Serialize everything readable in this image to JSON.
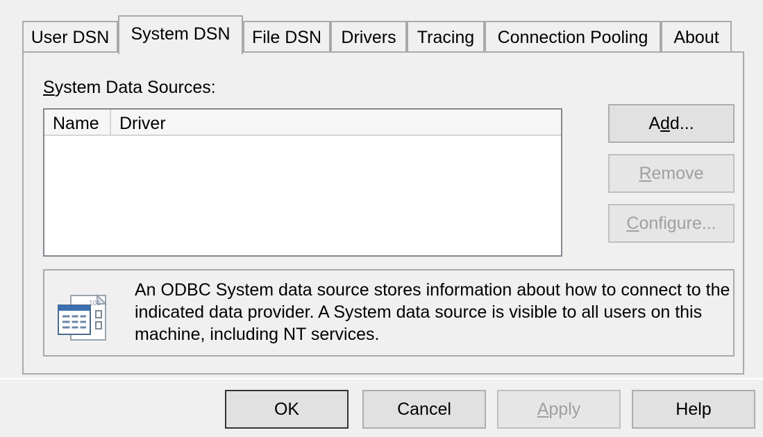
{
  "tabs": [
    {
      "label": "User DSN",
      "active": false
    },
    {
      "label": "System DSN",
      "active": true
    },
    {
      "label": "File DSN",
      "active": false
    },
    {
      "label": "Drivers",
      "active": false
    },
    {
      "label": "Tracing",
      "active": false
    },
    {
      "label": "Connection Pooling",
      "active": false
    },
    {
      "label": "About",
      "active": false
    }
  ],
  "section": {
    "label_first": "S",
    "label_rest": "ystem Data Sources:"
  },
  "list": {
    "columns": [
      "Name",
      "Driver"
    ],
    "rows": []
  },
  "side_buttons": {
    "add": {
      "pre": "A",
      "accel": "d",
      "post": "d...",
      "enabled": true
    },
    "remove": {
      "pre": "",
      "accel": "R",
      "post": "emove",
      "enabled": false
    },
    "configure": {
      "pre": "",
      "accel": "C",
      "post": "onfigure...",
      "enabled": false
    }
  },
  "info": {
    "icon": "data-source-icon",
    "text": "An ODBC System data source stores information about how to connect to the indicated data provider.   A System data source is visible to all users on this machine, including NT services."
  },
  "footer_buttons": {
    "ok": "OK",
    "cancel": "Cancel",
    "apply": {
      "pre": "",
      "accel": "A",
      "post": "pply",
      "enabled": false
    },
    "help": "Help"
  }
}
